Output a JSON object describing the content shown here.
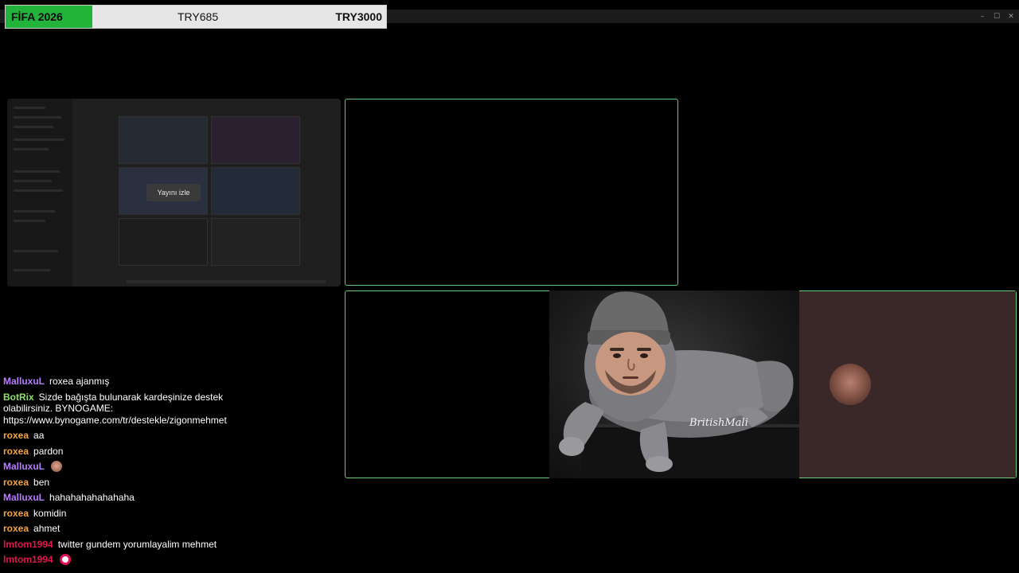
{
  "goal": {
    "name": "FİFA 2026",
    "current": "TRY685",
    "target": "TRY3000",
    "progress": 0.2283,
    "fill_color": "#22b33a"
  },
  "window_controls": {
    "minimize": "–",
    "maximize": "☐",
    "close": "✕"
  },
  "preview": {
    "watch_label": "Yayını izle"
  },
  "meme": {
    "caption": "BritishMali"
  },
  "colors": {
    "frame_border": "#6cc978",
    "brown_panel": "#3a2727"
  },
  "chat": {
    "messages": [
      {
        "user": "MalluxuL",
        "color": "#b77cff",
        "text": "roxea ajanmış",
        "emote": null
      },
      {
        "user": "BotRix",
        "color": "#8de06a",
        "text": "Sizde bağışta bulunarak kardeşinize destek olabilirsiniz. BYNOGAME: https://www.bynogame.com/tr/destekle/zigonmehmet",
        "emote": null
      },
      {
        "user": "roxea",
        "color": "#f1a340",
        "text": "aa",
        "emote": null
      },
      {
        "user": "roxea",
        "color": "#f1a340",
        "text": "pardon",
        "emote": null
      },
      {
        "user": "MalluxuL",
        "color": "#b77cff",
        "text": "",
        "emote": "face-emote"
      },
      {
        "user": "roxea",
        "color": "#f1a340",
        "text": "ben",
        "emote": null
      },
      {
        "user": "MalluxuL",
        "color": "#b77cff",
        "text": "hahahahahahahaha",
        "emote": null
      },
      {
        "user": "roxea",
        "color": "#f1a340",
        "text": "komidin",
        "emote": null
      },
      {
        "user": "roxea",
        "color": "#f1a340",
        "text": "ahmet",
        "emote": null
      },
      {
        "user": "lmtom1994",
        "color": "#e0164f",
        "text": "twitter gundem yorumlayalim mehmet",
        "emote": null
      },
      {
        "user": "lmtom1994",
        "color": "#e0164f",
        "text": "",
        "emote": "circle-emote"
      }
    ]
  }
}
